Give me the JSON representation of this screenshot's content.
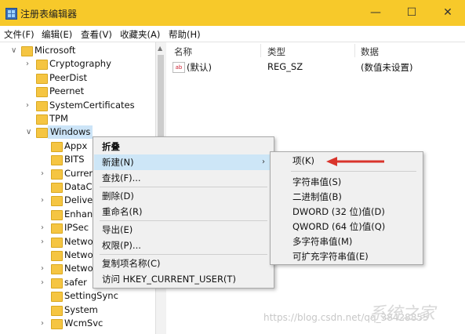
{
  "window": {
    "title": "注册表编辑器",
    "minimize": "—",
    "maximize": "☐",
    "close": "✕"
  },
  "menubar": [
    "文件(F)",
    "编辑(E)",
    "查看(V)",
    "收藏夹(A)",
    "帮助(H)"
  ],
  "tree": {
    "items": [
      {
        "label": "Microsoft",
        "expander": "∨",
        "level": 0
      },
      {
        "label": "Cryptography",
        "expander": "›",
        "level": 1
      },
      {
        "label": "PeerDist",
        "expander": "",
        "level": 1
      },
      {
        "label": "Peernet",
        "expander": "",
        "level": 1
      },
      {
        "label": "SystemCertificates",
        "expander": "›",
        "level": 1
      },
      {
        "label": "TPM",
        "expander": "",
        "level": 1
      },
      {
        "label": "Windows",
        "expander": "∨",
        "level": 1,
        "selected": true
      },
      {
        "label": "Appx",
        "expander": "",
        "level": 2
      },
      {
        "label": "BITS",
        "expander": "",
        "level": 2
      },
      {
        "label": "Currer",
        "expander": "›",
        "level": 2
      },
      {
        "label": "DataC",
        "expander": "",
        "level": 2
      },
      {
        "label": "Delive",
        "expander": "›",
        "level": 2
      },
      {
        "label": "Enhan",
        "expander": "",
        "level": 2
      },
      {
        "label": "IPSec",
        "expander": "›",
        "level": 2
      },
      {
        "label": "Netwo",
        "expander": "›",
        "level": 2
      },
      {
        "label": "Netwo",
        "expander": "",
        "level": 2
      },
      {
        "label": "Netwo",
        "expander": "›",
        "level": 2
      },
      {
        "label": "safer",
        "expander": "›",
        "level": 2
      },
      {
        "label": "SettingSync",
        "expander": "",
        "level": 2
      },
      {
        "label": "System",
        "expander": "",
        "level": 2
      },
      {
        "label": "WcmSvc",
        "expander": "›",
        "level": 2
      }
    ]
  },
  "values": {
    "headers": {
      "name": "名称",
      "type": "类型",
      "data": "数据"
    },
    "rows": [
      {
        "icon": "ab",
        "name": "(默认)",
        "type": "REG_SZ",
        "data": "(数值未设置)"
      }
    ]
  },
  "context_menu": {
    "items": [
      {
        "label": "折叠",
        "bold": true
      },
      {
        "label": "新建(N)",
        "submenu": true,
        "highlighted": true
      },
      {
        "label": "查找(F)..."
      },
      {
        "separator": true
      },
      {
        "label": "删除(D)"
      },
      {
        "label": "重命名(R)"
      },
      {
        "separator": true
      },
      {
        "label": "导出(E)"
      },
      {
        "label": "权限(P)..."
      },
      {
        "separator": true
      },
      {
        "label": "复制项名称(C)"
      },
      {
        "label": "访问 HKEY_CURRENT_USER(T)"
      }
    ],
    "submenu_arrow": "›"
  },
  "submenu": {
    "items": [
      {
        "label": "项(K)"
      },
      {
        "separator": true
      },
      {
        "label": "字符串值(S)"
      },
      {
        "label": "二进制值(B)"
      },
      {
        "label": "DWORD (32 位)值(D)"
      },
      {
        "label": "QWORD (64 位)值(Q)"
      },
      {
        "label": "多字符串值(M)"
      },
      {
        "label": "可扩充字符串值(E)"
      }
    ]
  },
  "annotation": {
    "color": "#d9342b"
  },
  "watermark": {
    "text": "https://blog.csdn.net/qq_38428855",
    "logo": "系统之家"
  }
}
